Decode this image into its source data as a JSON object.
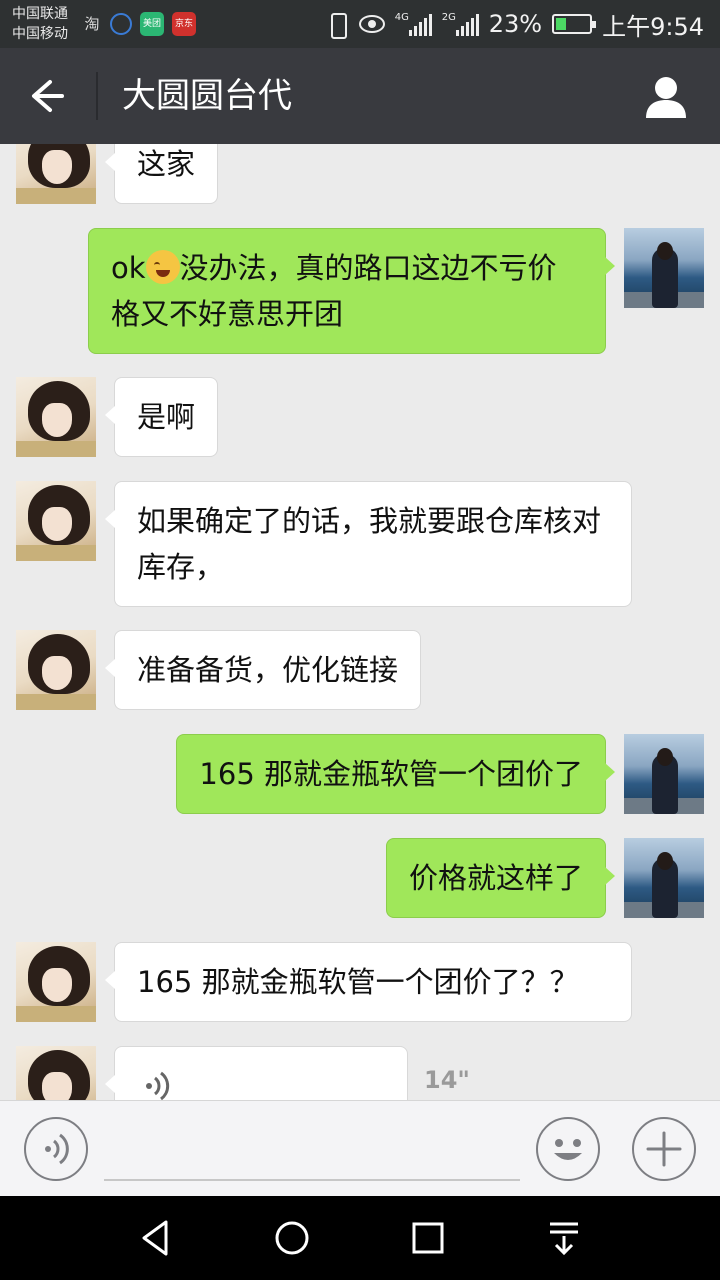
{
  "status_bar": {
    "carrier_1": "中国联通",
    "carrier_2": "中国移动",
    "notifications": [
      {
        "name": "taobao-icon",
        "label": "淘"
      },
      {
        "name": "music-icon",
        "label": ""
      },
      {
        "name": "meituan-icon",
        "label": "美团"
      },
      {
        "name": "jd-icon",
        "label": "京东"
      }
    ],
    "network_1": "4G",
    "network_2": "2G",
    "battery": "23%",
    "time": "上午9:54"
  },
  "title_bar": {
    "title": "大圆圆台代",
    "back_icon": "arrow-left-icon",
    "profile_icon": "person-icon"
  },
  "messages": [
    {
      "side": "in",
      "text": "这家"
    },
    {
      "side": "out",
      "prefix": "ok",
      "has_emoji": true,
      "text": "没办法，真的路口这边不亏价格又不好意思开团"
    },
    {
      "side": "in",
      "text": "是啊"
    },
    {
      "side": "in",
      "text": "如果确定了的话，我就要跟仓库核对库存，"
    },
    {
      "side": "in",
      "text": "准备备货，优化链接"
    },
    {
      "side": "out",
      "text": "165 那就金瓶软管一个团价了"
    },
    {
      "side": "out",
      "text": "价格就这样了"
    },
    {
      "side": "in",
      "text": "165 那就金瓶软管一个团价了？？"
    },
    {
      "side": "in",
      "type": "voice",
      "duration": "14\""
    }
  ],
  "input_bar": {
    "voice_icon": "voice-icon",
    "input_value": "",
    "emoji_icon": "emoji-icon",
    "plus_icon": "plus-icon"
  },
  "nav_bar": {
    "back": "nav-back-icon",
    "home": "nav-home-icon",
    "recents": "nav-recents-icon",
    "notifications": "nav-notification-icon"
  },
  "colors": {
    "title_bar": "#393a3f",
    "status_bar": "#2e3132",
    "chat_bg": "#ebebeb",
    "outgoing_bubble": "#a0e75a",
    "incoming_bubble": "#ffffff"
  }
}
